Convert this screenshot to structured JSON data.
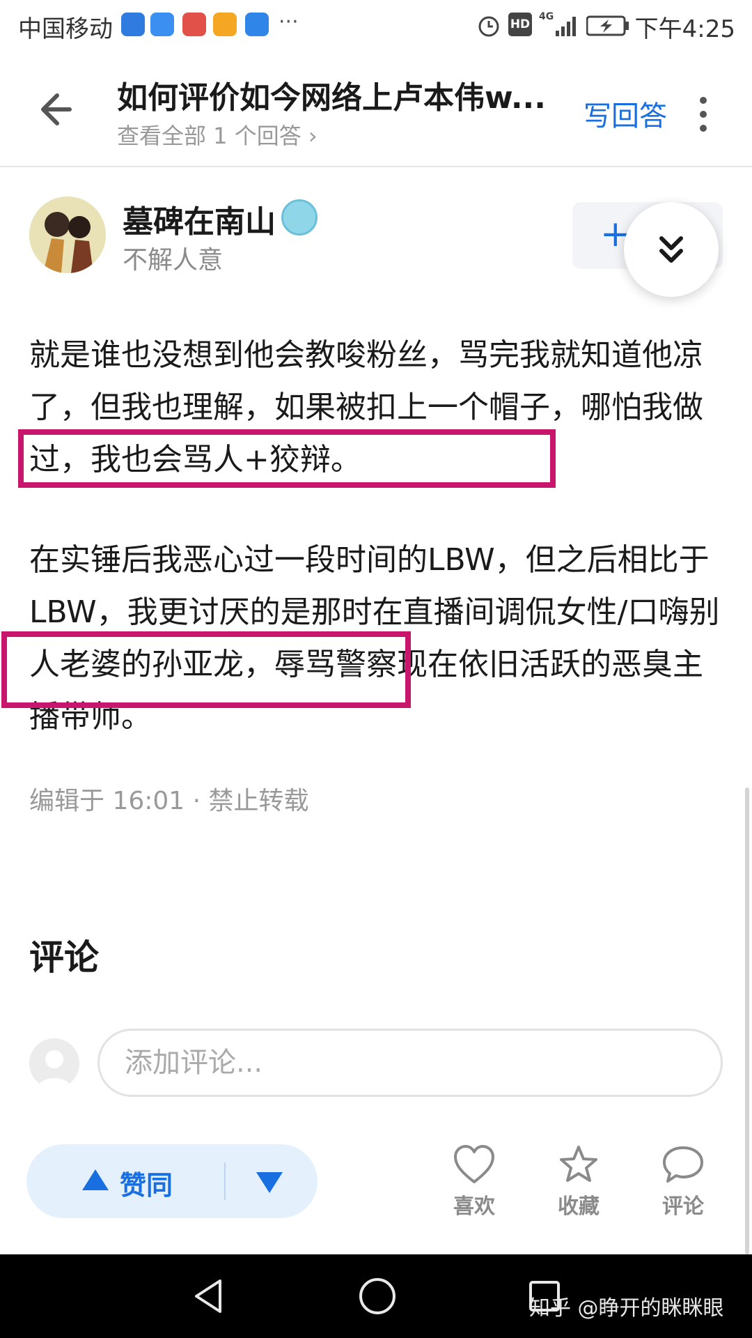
{
  "status_bar": {
    "carrier": "中国移动",
    "time": "下午4:25",
    "more": "···",
    "hd": "HD",
    "net": "4G"
  },
  "header": {
    "title": "如何评价如今网络上卢本伟w...",
    "subtitle": "查看全部 1 个回答 ›",
    "write_answer": "写回答"
  },
  "author": {
    "name": "墓碑在南山",
    "bio": "不解人意",
    "follow_label": "+"
  },
  "answer": {
    "paragraphs": [
      "就是谁也没想到他会教唆粉丝，骂完我就知道他凉了，但我也理解，如果被扣上一个帽子，哪怕我做过，我也会骂人+狡辩。",
      "在实锤后我恶心过一段时间的LBW，但之后相比于LBW，我更讨厌的是那时在直播间调侃女性/口嗨别人老婆的孙亚龙，辱骂警察现在依旧活跃的恶臭主播带师。"
    ],
    "meta": "编辑于 16:01 · 禁止转载",
    "highlight_color": "#c8166d"
  },
  "comments": {
    "title": "评论",
    "input_placeholder": "添加评论..."
  },
  "actions": {
    "upvote": "赞同",
    "like": "喜欢",
    "favorite": "收藏",
    "comment": "评论",
    "accent_color": "#1a6fe0"
  },
  "watermark": "知乎 @睁开的眯眯眼"
}
